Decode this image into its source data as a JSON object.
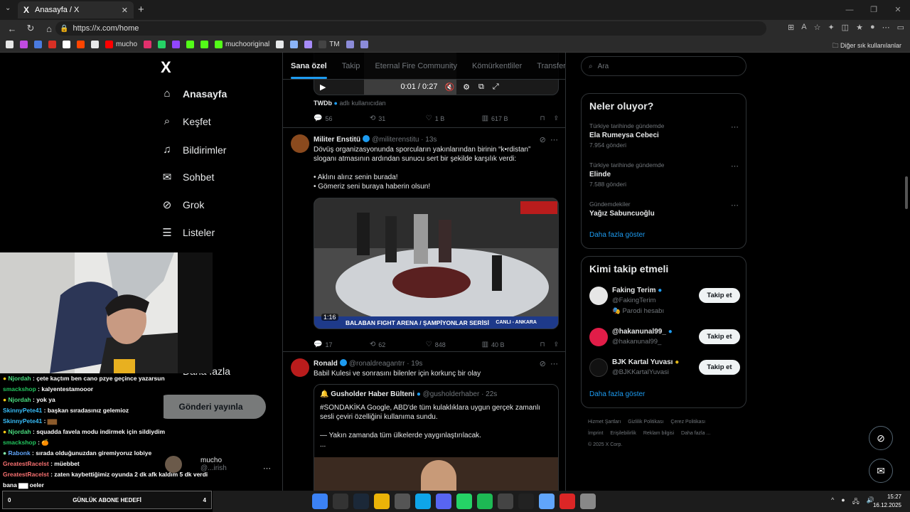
{
  "browser": {
    "tab_title": "Anasayfa / X",
    "tab_icon": "X",
    "new_tab": "+",
    "url": "https://x.com/home",
    "bookmarks": [
      {
        "label": "",
        "color": "#e6e6e6"
      },
      {
        "label": "",
        "color": "#c04be0"
      },
      {
        "label": "",
        "color": "#4a7be0"
      },
      {
        "label": "",
        "color": "#d93025"
      },
      {
        "label": "",
        "color": "#ffffff"
      },
      {
        "label": "",
        "color": "#ff4500"
      },
      {
        "label": "",
        "color": "#e7e9ea"
      },
      {
        "label": "mucho",
        "color": "#ff0000"
      },
      {
        "label": "",
        "color": "#e1306c"
      },
      {
        "label": "",
        "color": "#25d366"
      },
      {
        "label": "",
        "color": "#9146ff"
      },
      {
        "label": "",
        "color": "#53fc18"
      },
      {
        "label": "",
        "color": "#53fc18"
      },
      {
        "label": "muchooriginal",
        "color": "#53fc18"
      },
      {
        "label": "",
        "color": "#e7e9ea"
      },
      {
        "label": "",
        "color": "#8ab4f8"
      },
      {
        "label": "",
        "color": "#a78bfa"
      },
      {
        "label": "TM",
        "color": "#444444"
      },
      {
        "label": "",
        "color": "#8b8bd8"
      },
      {
        "label": "",
        "color": "#8b8bd8"
      }
    ],
    "other_bookmarks": "Diğer sık kullanılanlar"
  },
  "nav": {
    "logo": "X",
    "items": [
      {
        "label": "Anasayfa",
        "icon": "⌂"
      },
      {
        "label": "Keşfet",
        "icon": "⌕"
      },
      {
        "label": "Bildirimler",
        "icon": "♫"
      },
      {
        "label": "Sohbet",
        "icon": "✉"
      },
      {
        "label": "Grok",
        "icon": "⊘"
      },
      {
        "label": "Listeler",
        "icon": "☰"
      },
      {
        "label": "retleri",
        "icon": ""
      },
      {
        "label": "uklar",
        "icon": ""
      },
      {
        "label": "sal",
        "icon": ""
      },
      {
        "label": "Daha fazla",
        "icon": "⋯"
      }
    ],
    "post_button": "Gönderi yayınla",
    "account": {
      "name": "mucho",
      "handle": "@...irish"
    }
  },
  "chat": [
    {
      "user": "Njordah",
      "color": "#4ade80",
      "msg": "çete kaçtım ben cano pzye geçince yazarsun",
      "badge": true
    },
    {
      "user": "smackshop",
      "color": "#22c55e",
      "msg": "kalyentestamooor",
      "badge": false
    },
    {
      "user": "Njordah",
      "color": "#4ade80",
      "msg": "yok ya",
      "badge": true
    },
    {
      "user": "SkinnyPete41",
      "color": "#38bdf8",
      "msg": "başkan sıradasınız gelemioz",
      "badge": false
    },
    {
      "user": "SkinnyPete41",
      "color": "#38bdf8",
      "msg": "▆▆",
      "badge": false
    },
    {
      "user": "Njordah",
      "color": "#4ade80",
      "msg": "squadda favela modu indirmek için sildiydim",
      "badge": true
    },
    {
      "user": "smackshop",
      "color": "#22c55e",
      "msg": "🍊",
      "badge": false
    },
    {
      "user": "Rabonk",
      "color": "#60a5fa",
      "msg": "sırada olduğunuzdan giremiyoruz lobiye",
      "badge": true
    },
    {
      "user": "GreatestRacelst",
      "color": "#f87171",
      "msg": "müebbet",
      "badge": false
    },
    {
      "user": "GreatestRacelst",
      "color": "#f87171",
      "msg": "zaten kaybettiğimiz oyunda 2 dk afk kaldım 5 dk verdi",
      "badge": false
    },
    {
      "user": "",
      "color": "#ffffff",
      "msg": "bana ▆▆ oeler",
      "badge": false
    }
  ],
  "feed": {
    "tabs": [
      "Sana özel",
      "Takip",
      "Eternal Fire Community",
      "Kömürkentliler",
      "Transfer Yu"
    ],
    "top_post": {
      "time": "0:01 / 0:27",
      "source_name": "TWDb",
      "source_suffix": "adlı kullanıcıdan",
      "replies": "56",
      "retweets": "31",
      "likes": "1 B",
      "views": "617 B"
    },
    "post1": {
      "name": "Militer Enstitü",
      "handle": "@militerenstitu · 13s",
      "line1": "Dövüş organizasyonunda sporcuların yakınlarından birinin “k•rdistan”",
      "line2": "sloganı atmasının ardından sunucu sert bir şekilde karşılık verdi:",
      "line3": "• Aklını alırız senin burada!",
      "line4": "• Gömeriz seni buraya haberin olsun!",
      "video_duration": "1:16",
      "banner": "BALABAN FIGHT ARENA / ŞAMPİYONLAR SERİSİ",
      "live": "CANLI - ANKARA",
      "replies": "17",
      "retweets": "62",
      "likes": "848",
      "views": "40 B"
    },
    "post2": {
      "name": "Ronald",
      "handle": "@ronaldreagantrr · 19s",
      "text": "Babil Kulesi ve sonrasını bilenler için korkunç bir olay",
      "quote": {
        "name": "Gusholder Haber Bülteni",
        "handle": "@gusholderhaber · 22s",
        "line1": "#SONDAKİKA Google, ABD'de tüm kulaklıklara uygun gerçek zamanlı",
        "line2": "sesli çeviri özelliğini kullanıma sundu.",
        "line3": "— Yakın zamanda tüm ülkelerde yaygınlaştırılacak.",
        "line4": "..."
      }
    }
  },
  "right": {
    "search_placeholder": "Ara",
    "trends_title": "Neler oluyor?",
    "trends": [
      {
        "context": "Türkiye tarihinde gündemde",
        "name": "Ela Rumeysa Cebeci",
        "posts": "7.954 gönderi"
      },
      {
        "context": "Türkiye tarihinde gündemde",
        "name": "Elinde",
        "posts": "7.588 gönderi"
      },
      {
        "context": "Gündemdekiler",
        "name": "Yağız Sabuncuoğlu",
        "posts": ""
      }
    ],
    "show_more": "Daha fazla göster",
    "who_title": "Kimi takip etmeli",
    "suggestions": [
      {
        "name": "Faking Terim",
        "handle": "@FakingTerim",
        "extra": "🎭 Parodi hesabı",
        "button": "Takip et",
        "color": "#e6e6e6"
      },
      {
        "name": "@hakanunal99_",
        "handle": "@hakanunal99_",
        "extra": "",
        "button": "Takip et",
        "color": "#e11d48"
      },
      {
        "name": "BJK Kartal Yuvası",
        "handle": "@BJKKartalYuvasi",
        "extra": "",
        "button": "Takip et",
        "color": "#111111"
      }
    ],
    "show_more2": "Daha fazla göster",
    "footer": [
      "Hizmet Şartları",
      "Gizlilik Politikası",
      "Çerez Politikası",
      "İmprint",
      "Erişilebilirlik",
      "Reklam bilgisi",
      "Daha fazla ...",
      "© 2025 X Corp."
    ]
  },
  "stream": {
    "goal_left": "0",
    "goal_label": "GÜNLÜK ABONE HEDEFİ",
    "goal_right": "4"
  },
  "taskbar": {
    "time": "15:27",
    "date": "16.12.2025"
  }
}
